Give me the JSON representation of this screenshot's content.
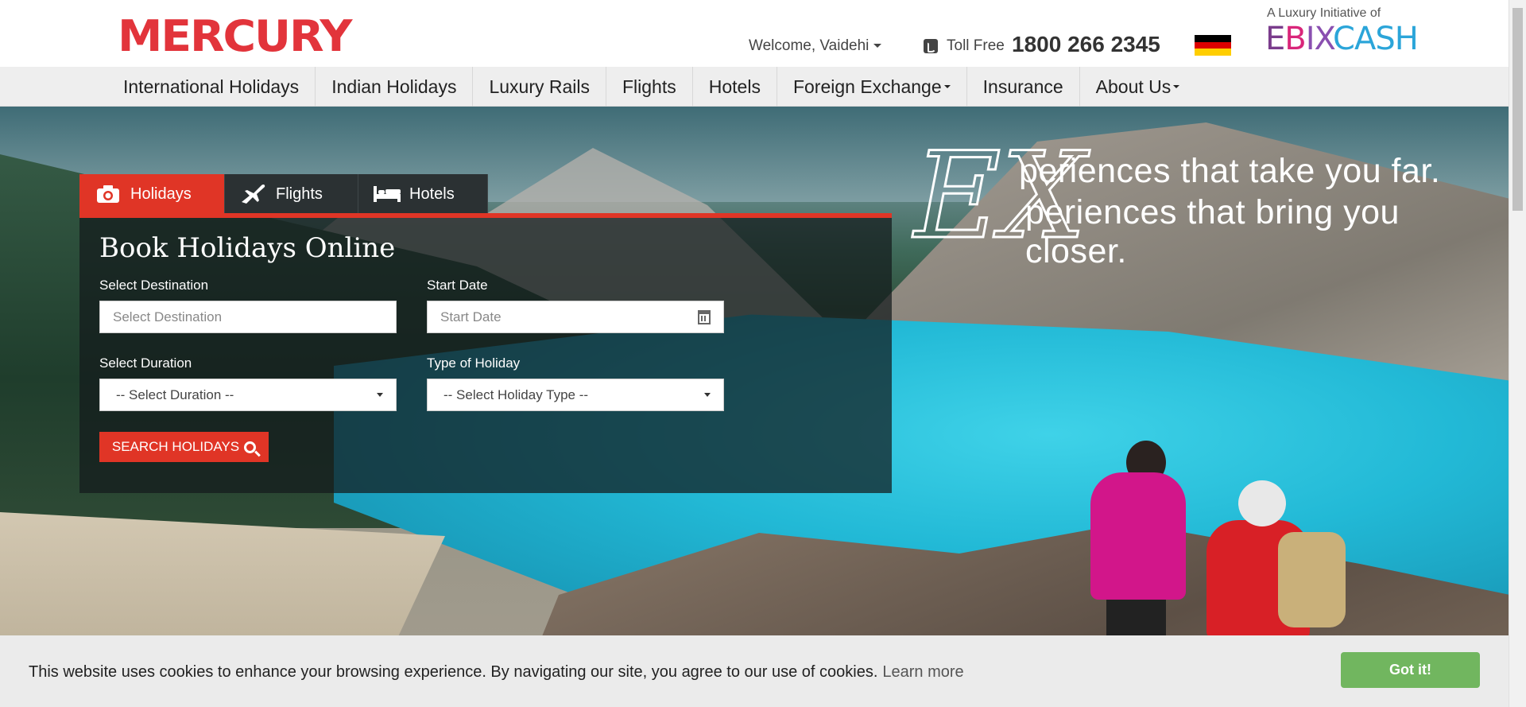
{
  "brand": {
    "logo": "MERCURY",
    "luxury_text": "A Luxury Initiative of",
    "partner_logo": "EBIXCASH"
  },
  "header": {
    "welcome": "Welcome, Vaidehi",
    "toll_free_label": "Toll Free",
    "toll_free_number": "1800 266 2345",
    "icons": {
      "phone": "phone-icon",
      "flag": "germany-flag-icon"
    }
  },
  "nav": {
    "items": [
      {
        "label": "International Holidays"
      },
      {
        "label": "Indian Holidays"
      },
      {
        "label": "Luxury Rails"
      },
      {
        "label": "Flights"
      },
      {
        "label": "Hotels"
      },
      {
        "label": "Foreign Exchange"
      },
      {
        "label": "Insurance"
      },
      {
        "label": "About Us"
      }
    ]
  },
  "hero": {
    "tagline_line1": "periences that take you far.",
    "tagline_line2": "periences that bring you closer.",
    "tagline_mark": "EX"
  },
  "booking": {
    "tabs": [
      {
        "label": "Holidays"
      },
      {
        "label": "Flights"
      },
      {
        "label": "Hotels"
      }
    ],
    "title": "Book Holidays Online",
    "destination_label": "Select Destination",
    "destination_placeholder": "Select Destination",
    "start_date_label": "Start Date",
    "start_date_placeholder": "Start Date",
    "duration_label": "Select Duration",
    "duration_value": "-- Select Duration --",
    "type_label": "Type of Holiday",
    "type_value": "-- Select Holiday Type --",
    "search_button": "SEARCH HOLIDAYS"
  },
  "cookie": {
    "text": "This website uses cookies to enhance your browsing experience. By navigating our site, you agree to our use of cookies.",
    "link": "Learn more",
    "button": "Got it!"
  },
  "colors": {
    "brand_red": "#e03526",
    "cookie_green": "#71b65f",
    "nav_bg": "#eeeeee"
  }
}
